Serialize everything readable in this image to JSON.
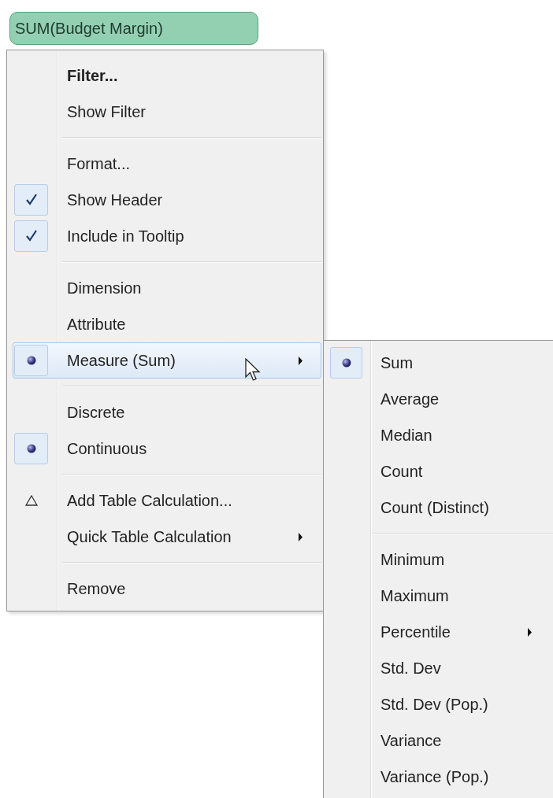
{
  "pill": {
    "label": "SUM(Budget Margin)"
  },
  "menu": {
    "items": [
      {
        "kind": "command",
        "label": "Filter...",
        "bold": true,
        "highlighted": false,
        "submenu": false
      },
      {
        "kind": "command",
        "label": "Show Filter",
        "bold": false,
        "highlighted": false,
        "submenu": false
      },
      {
        "kind": "separator"
      },
      {
        "kind": "command",
        "label": "Format...",
        "bold": false,
        "highlighted": false,
        "submenu": false
      },
      {
        "kind": "check",
        "label": "Show Header",
        "checked": true,
        "bold": false,
        "highlighted": false,
        "submenu": false
      },
      {
        "kind": "check",
        "label": "Include in Tooltip",
        "checked": true,
        "bold": false,
        "highlighted": false,
        "submenu": false
      },
      {
        "kind": "separator"
      },
      {
        "kind": "radio",
        "label": "Dimension",
        "checked": false,
        "bold": false,
        "highlighted": false,
        "submenu": false
      },
      {
        "kind": "radio",
        "label": "Attribute",
        "checked": false,
        "bold": false,
        "highlighted": false,
        "submenu": false
      },
      {
        "kind": "radio",
        "label": "Measure (Sum)",
        "checked": true,
        "bold": false,
        "highlighted": true,
        "submenu": true
      },
      {
        "kind": "separator"
      },
      {
        "kind": "radio",
        "label": "Discrete",
        "checked": false,
        "bold": false,
        "highlighted": false,
        "submenu": false
      },
      {
        "kind": "radio",
        "label": "Continuous",
        "checked": true,
        "bold": false,
        "highlighted": false,
        "submenu": false
      },
      {
        "kind": "separator"
      },
      {
        "kind": "calc",
        "label": "Add Table Calculation...",
        "bold": false,
        "highlighted": false,
        "submenu": false
      },
      {
        "kind": "command",
        "label": "Quick Table Calculation",
        "bold": false,
        "highlighted": false,
        "submenu": true
      },
      {
        "kind": "separator"
      },
      {
        "kind": "command",
        "label": "Remove",
        "bold": false,
        "highlighted": false,
        "submenu": false
      }
    ]
  },
  "submenu": {
    "items": [
      {
        "kind": "radio",
        "label": "Sum",
        "checked": true,
        "bold": false,
        "highlighted": false,
        "submenu": false
      },
      {
        "kind": "radio",
        "label": "Average",
        "checked": false,
        "bold": false,
        "highlighted": false,
        "submenu": false
      },
      {
        "kind": "radio",
        "label": "Median",
        "checked": false,
        "bold": false,
        "highlighted": false,
        "submenu": false
      },
      {
        "kind": "radio",
        "label": "Count",
        "checked": false,
        "bold": false,
        "highlighted": false,
        "submenu": false
      },
      {
        "kind": "radio",
        "label": "Count (Distinct)",
        "checked": false,
        "bold": false,
        "highlighted": false,
        "submenu": false
      },
      {
        "kind": "separator"
      },
      {
        "kind": "radio",
        "label": "Minimum",
        "checked": false,
        "bold": false,
        "highlighted": false,
        "submenu": false
      },
      {
        "kind": "radio",
        "label": "Maximum",
        "checked": false,
        "bold": false,
        "highlighted": false,
        "submenu": false
      },
      {
        "kind": "radio",
        "label": "Percentile",
        "checked": false,
        "bold": false,
        "highlighted": false,
        "submenu": true
      },
      {
        "kind": "radio",
        "label": "Std. Dev",
        "checked": false,
        "bold": false,
        "highlighted": false,
        "submenu": false
      },
      {
        "kind": "radio",
        "label": "Std. Dev (Pop.)",
        "checked": false,
        "bold": false,
        "highlighted": false,
        "submenu": false
      },
      {
        "kind": "radio",
        "label": "Variance",
        "checked": false,
        "bold": false,
        "highlighted": false,
        "submenu": false
      },
      {
        "kind": "radio",
        "label": "Variance (Pop.)",
        "checked": false,
        "bold": false,
        "highlighted": false,
        "submenu": false
      }
    ]
  }
}
